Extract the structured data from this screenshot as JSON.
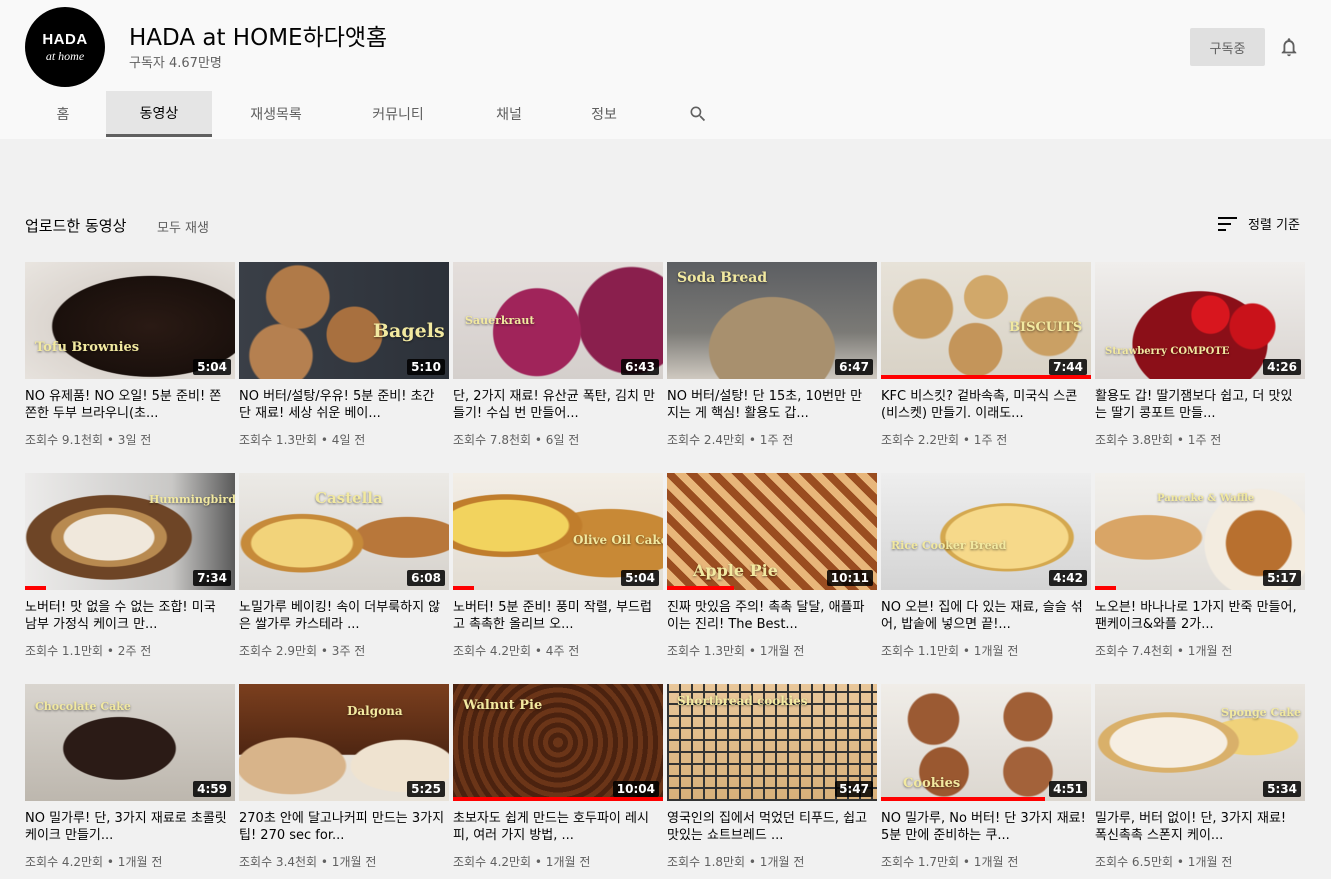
{
  "channel": {
    "avatar_line1": "HADA",
    "avatar_line2": "at home",
    "name": "HADA at HOME하다앳홈",
    "subscribers": "구독자 4.67만명",
    "subscribe_label": "구독중"
  },
  "tabs": [
    {
      "label": "홈"
    },
    {
      "label": "동영상"
    },
    {
      "label": "재생목록"
    },
    {
      "label": "커뮤니티"
    },
    {
      "label": "채널"
    },
    {
      "label": "정보"
    }
  ],
  "section": {
    "title": "업로드한 동영상",
    "play_all": "모두 재생",
    "sort_label": "정렬 기준"
  },
  "videos": [
    {
      "title": "NO 유제품! NO 오일! 5분 준비! 쫀쫀한 두부 브라우니(초...",
      "meta": "조회수 9.1천회 • 3일 전",
      "duration": "5:04",
      "thumb_text": "Tofu Brownies",
      "progress": 0
    },
    {
      "title": "NO 버터/설탕/우유! 5분 준비! 초간단 재료! 세상 쉬운 베이...",
      "meta": "조회수 1.3만회 • 4일 전",
      "duration": "5:10",
      "thumb_text": "Bagels",
      "progress": 0
    },
    {
      "title": "단, 2가지 재료! 유산균 폭탄, 김치 만들기! 수십 번 만들어...",
      "meta": "조회수 7.8천회 • 6일 전",
      "duration": "6:43",
      "thumb_text": "Sauerkraut",
      "progress": 0
    },
    {
      "title": "NO 버터/설탕! 단 15초, 10번만 만지는 게 핵심! 활용도 갑...",
      "meta": "조회수 2.4만회 • 1주 전",
      "duration": "6:47",
      "thumb_text": "Soda Bread",
      "progress": 0
    },
    {
      "title": "KFC 비스킷? 겉바속촉, 미국식 스콘(비스켓) 만들기. 이래도...",
      "meta": "조회수 2.2만회 • 1주 전",
      "duration": "7:44",
      "thumb_text": "BISCUITS",
      "progress": 1.0
    },
    {
      "title": "활용도 갑! 딸기잼보다 쉽고, 더 맛있는 딸기 콩포트 만들...",
      "meta": "조회수 3.8만회 • 1주 전",
      "duration": "4:26",
      "thumb_text": "Strawberry COMPOTE",
      "progress": 0
    },
    {
      "title": "노버터! 맛 없을 수 없는 조합! 미국 남부 가정식 케이크 만...",
      "meta": "조회수 1.1만회 • 2주 전",
      "duration": "7:34",
      "thumb_text": "Hummingbird CAKE",
      "progress": 0.1
    },
    {
      "title": "노밀가루 베이킹! 속이 더부룩하지 않은 쌀가루 카스테라 ...",
      "meta": "조회수 2.9만회 • 3주 전",
      "duration": "6:08",
      "thumb_text": "Castella",
      "progress": 0
    },
    {
      "title": "노버터! 5분 준비! 풍미 작렬, 부드럽고 촉촉한 올리브 오...",
      "meta": "조회수 4.2만회 • 4주 전",
      "duration": "5:04",
      "thumb_text": "Olive Oil Cake",
      "progress": 0.1
    },
    {
      "title": "진짜 맛있음 주의! 촉촉 달달, 애플파이는 진리! The Best...",
      "meta": "조회수 1.3만회 • 1개월 전",
      "duration": "10:11",
      "thumb_text": "Apple Pie",
      "progress": 0.32
    },
    {
      "title": "NO 오븐! 집에 다 있는 재료, 슬슬 섞어, 밥솥에 넣으면 끝!...",
      "meta": "조회수 1.1만회 • 1개월 전",
      "duration": "4:42",
      "thumb_text": "Rice Cooker Bread",
      "progress": 0
    },
    {
      "title": "노오븐! 바나나로 1가지 반죽 만들어, 팬케이크&와플 2가...",
      "meta": "조회수 7.4천회 • 1개월 전",
      "duration": "5:17",
      "thumb_text": "Pancake & Waffle",
      "progress": 0.1
    },
    {
      "title": "NO 밀가루! 단, 3가지 재료로 초콜릿 케이크 만들기...",
      "meta": "조회수 4.2만회 • 1개월 전",
      "duration": "4:59",
      "thumb_text": "Chocolate Cake",
      "progress": 0
    },
    {
      "title": "270초 안에 달고나커피 만드는 3가지 팁! 270 sec for...",
      "meta": "조회수 3.4천회 • 1개월 전",
      "duration": "5:25",
      "thumb_text": "Dalgona",
      "progress": 0
    },
    {
      "title": "초보자도 쉽게 만드는 호두파이 레시피, 여러 가지 방법, ...",
      "meta": "조회수 4.2만회 • 1개월 전",
      "duration": "10:04",
      "thumb_text": "Walnut Pie",
      "progress": 1.0
    },
    {
      "title": "영국인의 집에서 먹었던 티푸드, 쉽고 맛있는 쇼트브레드 ...",
      "meta": "조회수 1.8만회 • 1개월 전",
      "duration": "5:47",
      "thumb_text": "Shortbread cookies",
      "progress": 0
    },
    {
      "title": "NO 밀가루, No 버터! 단 3가지 재료! 5분 만에 준비하는 쿠...",
      "meta": "조회수 1.7만회 • 1개월 전",
      "duration": "4:51",
      "thumb_text": "Cookies",
      "progress": 0.78
    },
    {
      "title": "밀가루, 버터 없이! 단, 3가지 재료! 폭신촉촉 스폰지 케이...",
      "meta": "조회수 6.5만회 • 1개월 전",
      "duration": "5:34",
      "thumb_text": "Sponge Cake",
      "progress": 0
    }
  ],
  "colors": {
    "accent": "#ff0000",
    "secondary_text": "#606060",
    "background": "#f1f1f1",
    "header_background": "#f9f9f9"
  }
}
